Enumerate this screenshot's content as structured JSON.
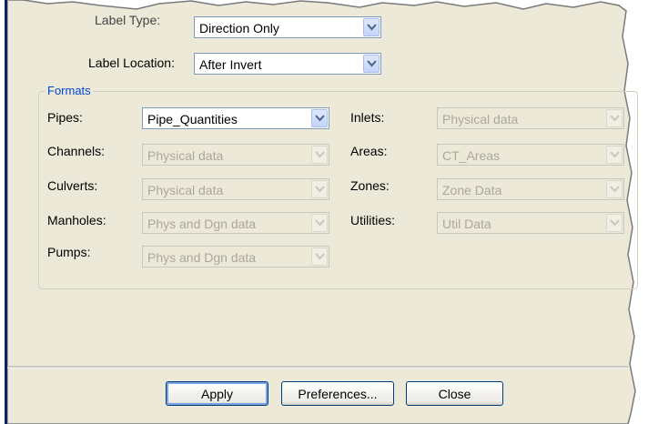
{
  "top": {
    "label_type": {
      "label": "Label Type:",
      "value": "Direction Only"
    },
    "label_location": {
      "label": "Label Location:",
      "value": "After Invert"
    }
  },
  "formats": {
    "title": "Formats",
    "rows": [
      {
        "label": "Pipes:",
        "value": "Pipe_Quantities",
        "enabled": true
      },
      {
        "label": "Channels:",
        "value": "Physical data",
        "enabled": false
      },
      {
        "label": "Culverts:",
        "value": "Physical data",
        "enabled": false
      },
      {
        "label": "Manholes:",
        "value": "Phys and Dgn data",
        "enabled": false
      },
      {
        "label": "Pumps:",
        "value": "Phys and Dgn data",
        "enabled": false
      },
      {
        "label": "Inlets:",
        "value": "Physical data",
        "enabled": false
      },
      {
        "label": "Areas:",
        "value": "CT_Areas",
        "enabled": false
      },
      {
        "label": "Zones:",
        "value": "Zone Data",
        "enabled": false
      },
      {
        "label": "Utilities:",
        "value": "Util Data",
        "enabled": false
      }
    ]
  },
  "buttons": {
    "apply": "Apply",
    "preferences": "Preferences...",
    "close": "Close"
  },
  "icons": {
    "dropdown": "chevron-down-icon"
  },
  "colors": {
    "dialog_bg": "#ece9d8",
    "groupbox_title": "#0046d5",
    "accent": "#316ac5"
  }
}
